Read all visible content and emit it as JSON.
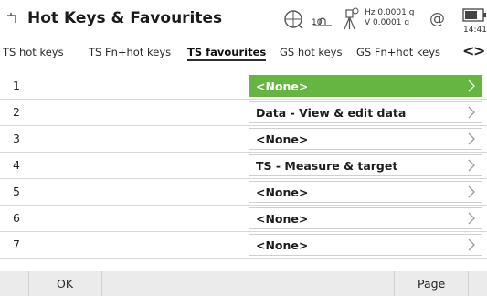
{
  "header": {
    "title": "Hot Keys & Favourites",
    "status": {
      "sat_count": "10",
      "hz": "Hz 0.0001 g",
      "v": "V  0.0001 g",
      "time": "14:41"
    }
  },
  "tabs": [
    {
      "label": "TS hot keys",
      "active": false
    },
    {
      "label": "TS Fn+hot keys",
      "active": false
    },
    {
      "label": "TS favourites",
      "active": true
    },
    {
      "label": "GS hot keys",
      "active": false
    },
    {
      "label": "GS Fn+hot keys",
      "active": false
    }
  ],
  "rows": [
    {
      "index": "1",
      "value": "<None>",
      "selected": true
    },
    {
      "index": "2",
      "value": "Data - View & edit data",
      "selected": false
    },
    {
      "index": "3",
      "value": "<None>",
      "selected": false
    },
    {
      "index": "4",
      "value": "TS - Measure & target",
      "selected": false
    },
    {
      "index": "5",
      "value": "<None>",
      "selected": false
    },
    {
      "index": "6",
      "value": "<None>",
      "selected": false
    },
    {
      "index": "7",
      "value": "<None>",
      "selected": false
    }
  ],
  "footer": {
    "ok_label": "OK",
    "page_label": "Page"
  },
  "colors": {
    "selected": "#66b543",
    "row_border": "#d7d7d7",
    "footer_bg": "#ebebeb"
  }
}
